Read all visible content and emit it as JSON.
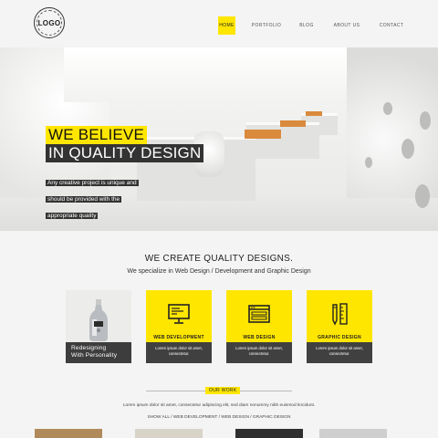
{
  "logo": {
    "text": "LOGO"
  },
  "nav": {
    "items": [
      {
        "label": "HOME",
        "active": true
      },
      {
        "label": "PORTFOLIO",
        "active": false
      },
      {
        "label": "BLOG",
        "active": false
      },
      {
        "label": "ABOUT US",
        "active": false
      },
      {
        "label": "CONTACT",
        "active": false
      }
    ]
  },
  "hero": {
    "title_line1": "WE BELIEVE",
    "title_line2": "IN QUALITY DESIGN",
    "subtitle": "Any creative project is unique and should be provided with the appropriate quality"
  },
  "main": {
    "title": "WE CREATE QUALITY DESIGNS.",
    "subtitle": "We specialize in Web Design / Development and Graphic Design"
  },
  "cards": [
    {
      "type": "photo",
      "title_line1": "Redesigning",
      "title_line2": "With Personality"
    },
    {
      "type": "service",
      "icon": "monitor-icon",
      "heading": "WEB DEVELOPMENT",
      "text": "Lorem ipsum dolor sit amet, consectetur."
    },
    {
      "type": "service",
      "icon": "browser-window-icon",
      "heading": "WEB DESIGN",
      "text": "Lorem ipsum dolor sit amet, consectetur."
    },
    {
      "type": "service",
      "icon": "pencil-ruler-icon",
      "heading": "GRAPHIC DESIGN",
      "text": "Lorem ipsum dolor sit amet, consectetur."
    }
  ],
  "our_work": {
    "label": "OUR WORK",
    "description": "Lorem ipsum dolor sit amet, consectetur adipiscing elit, sed diam nonummy nibh euismod tincidunt.",
    "filter": "SHOW ALL / WEB DEVELOPMENT / WEB DESIGN / GRAPHIC DESIGN"
  },
  "colors": {
    "accent": "#ffe600",
    "dark": "#404040",
    "background": "#f4f4f4"
  }
}
